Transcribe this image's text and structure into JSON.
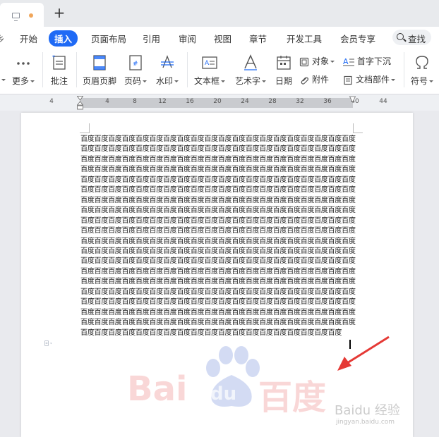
{
  "tabbar": {
    "new_tab": "+"
  },
  "menu": {
    "items": [
      "开始",
      "插入",
      "页面布局",
      "引用",
      "审阅",
      "视图",
      "章节",
      "开发工具",
      "会员专享"
    ],
    "active": "插入",
    "search": "查找",
    "left_cut": "乡"
  },
  "toolbar": {
    "more": "更多",
    "comment": "批注",
    "header_footer": "页眉页脚",
    "page_number": "页码",
    "watermark": "水印",
    "textbox": "文本框",
    "wordart": "艺术字",
    "date": "日期",
    "object": "对象",
    "attachment": "附件",
    "drop_cap": "首字下沉",
    "doc_parts": "文档部件",
    "symbol": "符号"
  },
  "ruler": {
    "labels": [
      "4",
      "4",
      "8",
      "12",
      "16",
      "20",
      "24",
      "28",
      "32",
      "36",
      "40",
      "44"
    ]
  },
  "document": {
    "repeat_unit": "百度",
    "line_count": 21
  },
  "watermark": {
    "main_latin": "Bai",
    "main_du": "du",
    "main_cjk": "百度",
    "secondary": "Baidu 经验",
    "secondary_url": "jingyan.baidu.com"
  },
  "colors": {
    "accent": "#1f6af5",
    "arrow": "#e53935",
    "watermark_red": "#e84c4c",
    "watermark_blue": "#3a5fcd"
  }
}
